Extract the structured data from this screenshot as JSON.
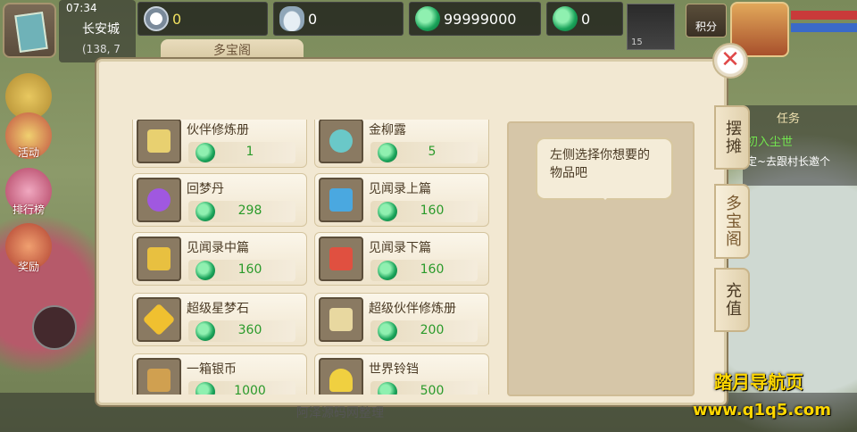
{
  "hud": {
    "time": "07:34",
    "city": "长安城",
    "coord": "(138, 7",
    "resources": [
      {
        "id": "gong",
        "icon": "tribute-coin-icon",
        "value": "0",
        "color": "#f0e060"
      },
      {
        "id": "silver",
        "icon": "silver-ingot-icon",
        "value": "0",
        "color": "#ffffff"
      },
      {
        "id": "jade",
        "icon": "jade-coin-icon",
        "value": "99999000",
        "color": "#ffffff"
      },
      {
        "id": "locked_jade",
        "icon": "locked-jade-icon",
        "value": "0",
        "color": "#ffffff"
      }
    ],
    "score_label": "积分",
    "portrait_level": "15"
  },
  "left_menu": [
    {
      "label": "活动",
      "icon": "horn-icon"
    },
    {
      "label": "排行榜",
      "icon": "ranking-icon"
    },
    {
      "label": "奖励",
      "icon": "gift-icon"
    }
  ],
  "task": {
    "title": "任务",
    "name": "初入尘世",
    "desc": "定~去跟村长邀个"
  },
  "dialog": {
    "title": "多宝阁",
    "hint": "左侧选择你想要的物品吧",
    "tabs": [
      "摆摊",
      "多宝阁",
      "充值"
    ],
    "active_tab": 1,
    "items": [
      {
        "name": "伙伴修炼册",
        "price": "1",
        "icon": "book-icon",
        "color": "#e8d070"
      },
      {
        "name": "金柳露",
        "price": "5",
        "icon": "potion-icon",
        "color": "#6ac8c8"
      },
      {
        "name": "回梦丹",
        "price": "298",
        "icon": "pill-icon",
        "color": "#a058e0"
      },
      {
        "name": "见闻录上篇",
        "price": "160",
        "icon": "scroll-blue-icon",
        "color": "#4aa8e0"
      },
      {
        "name": "见闻录中篇",
        "price": "160",
        "icon": "scroll-yellow-icon",
        "color": "#e8c040"
      },
      {
        "name": "见闻录下篇",
        "price": "160",
        "icon": "scroll-red-icon",
        "color": "#e05040"
      },
      {
        "name": "超级星梦石",
        "price": "360",
        "icon": "star-stone-icon",
        "color": "#f0c030"
      },
      {
        "name": "超级伙伴修炼册",
        "price": "200",
        "icon": "book-icon",
        "color": "#e8d8a0"
      },
      {
        "name": "一箱银币",
        "price": "1000",
        "icon": "chest-icon",
        "color": "#d0a050"
      },
      {
        "name": "世界铃铛",
        "price": "500",
        "icon": "bell-icon",
        "color": "#f0d040"
      }
    ]
  },
  "footer_text": "阿泽源码网整理",
  "watermark": {
    "line1": "踏月导航页",
    "line2": "www.q1q5.com"
  }
}
